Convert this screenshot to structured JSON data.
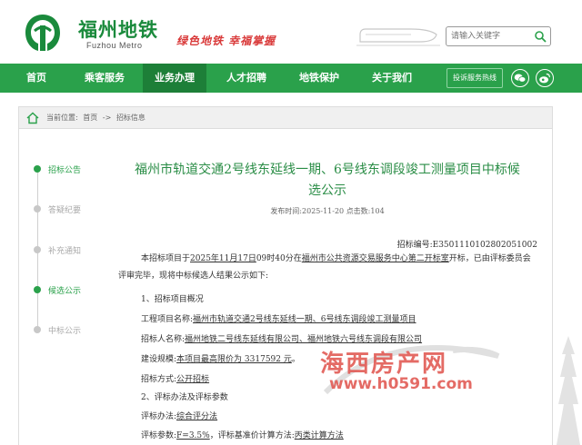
{
  "header": {
    "logo_cn": "福州地铁",
    "logo_en": "Fuzhou Metro",
    "slogan": "绿色地铁 幸福掌握",
    "search_placeholder": "请输入关键字"
  },
  "nav": {
    "items": [
      "首页",
      "乘客服务",
      "业务办理",
      "人才招聘",
      "地铁保护",
      "关于我们"
    ],
    "active": "业务办理",
    "hotline": "投诉服务热线"
  },
  "breadcrumb": {
    "prefix": "当前位置:",
    "home": "首页",
    "sep": "->",
    "current": "招标信息"
  },
  "timeline": [
    "招标公告",
    "答疑纪要",
    "补充通知",
    "候选公示",
    "中标公示"
  ],
  "timeline_active": "候选公示",
  "article": {
    "title_line1": "福州市轨道交通2号线东延线一期、6号线东调段竣工测量项目中标候",
    "title_line2": "选公示",
    "publish_label": "发布时间:",
    "publish_date": "2025-11-20",
    "clicks_label": "点击数:",
    "clicks": "104",
    "code_label": "招标编号:",
    "code": "E3501110102802051002",
    "intro_1": "本招标项目于",
    "intro_date": "2025年11月17日",
    "intro_2": "09时40分在",
    "intro_place": "福州市公共资源交易服务中心第二开标室",
    "intro_3": "开标，已由评标委员会",
    "intro_4": "评审完毕，现将中标候选人结果公示如下:",
    "s1": "1、招标项目概况",
    "proj_label": "工程项目名称:",
    "proj": "福州市轨道交通2号线东延线一期、6号线东调段竣工测量项目",
    "tenderer_label": "招标人名称:",
    "tenderer": "福州地铁二号线东延线有限公司、福州地铁六号线东调段有限公司",
    "scale_label": "建设规模:",
    "scale": "本项目最高限价为 3317592 元",
    "method_label": "招标方式:",
    "method": "公开招标",
    "s2": "2、评标办法及评标参数",
    "eval_label": "评标办法:",
    "eval": "综合评分法",
    "param_label": "评标参数:",
    "param": "F=3.5%",
    "base_label": "，评标基准价计算方法:",
    "base": "丙类计算方法"
  },
  "watermark": {
    "cn": "海西房产网",
    "url": "www.h0591.com"
  },
  "colors": {
    "brand_green": "#2aa14b",
    "dark_green": "#1d7f38",
    "slogan_red": "#d93a3a",
    "watermark_red": "#e25b55"
  }
}
